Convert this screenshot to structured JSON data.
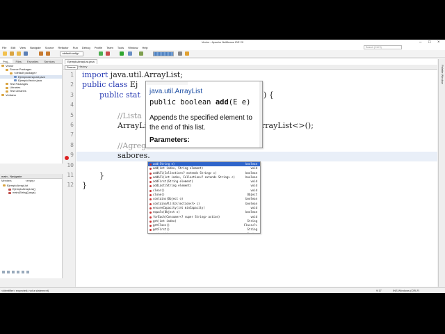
{
  "window": {
    "title": "Vector - Apache NetBeans IDE 20"
  },
  "menu": [
    "File",
    "Edit",
    "View",
    "Navigate",
    "Source",
    "Refactor",
    "Run",
    "Debug",
    "Profile",
    "Team",
    "Tools",
    "Window",
    "Help"
  ],
  "search_placeholder": "Search (Ctrl+I)",
  "toolbar": {
    "config": "<default config>"
  },
  "projects": {
    "tabs": [
      "Proj...",
      "Files",
      "Favorites",
      "Services"
    ],
    "tree": [
      "Vector",
      "Source Packages",
      "<default package>",
      "EjemploArrayList.java",
      "EjemploVector.java",
      "Test Packages",
      "Libraries",
      "Test Libraries",
      "Ventana"
    ]
  },
  "navigator": {
    "header": "main - Navigator",
    "filter_left": "Members",
    "filter_right": "<empty>",
    "items": [
      "EjemploArrayList",
      "EjemploArrayList()",
      "main(String[] args)"
    ]
  },
  "editor": {
    "file_tab": "EjemploArrayList.java",
    "source_label": "Source",
    "history_label": "History",
    "line_numbers": [
      "1",
      "2",
      "3",
      "4",
      "5",
      "6",
      "7",
      "8",
      "9",
      "10",
      "11",
      "12"
    ],
    "lines": {
      "l1_kw": "import",
      "l1_rest": " java.util.ArrayList;",
      "l2_kw": "public class",
      "l2_rest": " Ej",
      "l3_kw": "public stat",
      "l3_tail": ") {",
      "l5": "//Lista",
      "l6_a": "ArrayLi",
      "l6_b": "rrayList<>();",
      "l8": "//Agreg",
      "l9": "sabores.",
      "l11": "}",
      "l12": "}"
    }
  },
  "javadoc": {
    "class_name": "java.util.ArrayList",
    "signature_prefix": "public boolean ",
    "method": "add",
    "signature_suffix": "(E e)",
    "description": "Appends the specified element to the end of this list.",
    "params_label": "Parameters:"
  },
  "completion": {
    "items": [
      {
        "sig": "add(String e)",
        "ret": "boolean"
      },
      {
        "sig": "add(int index, String element)",
        "ret": "void"
      },
      {
        "sig": "addAll(Collection<? extends String> c)",
        "ret": "boolean"
      },
      {
        "sig": "addAll(int index, Collection<? extends String> c)",
        "ret": "boolean"
      },
      {
        "sig": "addFirst(String element)",
        "ret": "void"
      },
      {
        "sig": "addLast(String element)",
        "ret": "void"
      },
      {
        "sig": "clear()",
        "ret": "void"
      },
      {
        "sig": "clone()",
        "ret": "Object"
      },
      {
        "sig": "contains(Object o)",
        "ret": "boolean"
      },
      {
        "sig": "containsAll(Collection<?> c)",
        "ret": "boolean"
      },
      {
        "sig": "ensureCapacity(int minCapacity)",
        "ret": "void"
      },
      {
        "sig": "equals(Object o)",
        "ret": "boolean"
      },
      {
        "sig": "forEach(Consumer<? super String> action)",
        "ret": "void"
      },
      {
        "sig": "get(int index)",
        "ret": "String"
      },
      {
        "sig": "getClass()",
        "ret": "Class<?>"
      },
      {
        "sig": "getFirst()",
        "ret": "String"
      },
      {
        "sig": "getLast()",
        "ret": "String"
      }
    ]
  },
  "status": {
    "message": "<identifier> expected; not a statement)",
    "position": "9:17",
    "mode": "INS  Windows (CRLF)"
  },
  "right_panel": "Palette Window",
  "colors": {
    "keyword": "#2d3fb5",
    "comment": "#9a9a9a",
    "selection": "#2f65ca",
    "javadoc_class": "#1e4fa3",
    "error": "#dd2222"
  }
}
